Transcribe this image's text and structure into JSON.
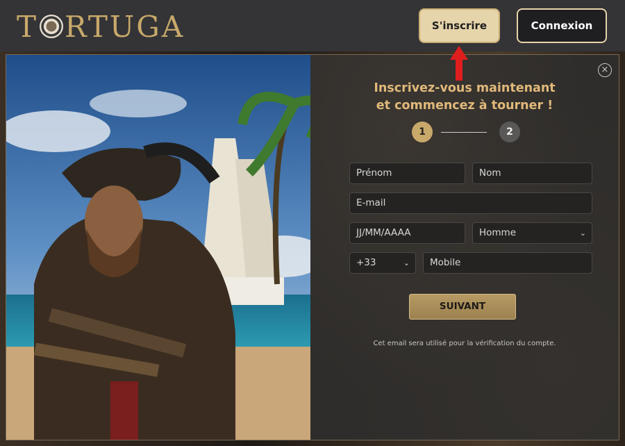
{
  "header": {
    "logo_text_left": "T",
    "logo_text_right": "RTUGA",
    "signup_label": "S'inscrire",
    "login_label": "Connexion"
  },
  "modal": {
    "title_line1": "Inscrivez-vous maintenant",
    "title_line2": "et commencez à tourner !",
    "close_icon": "×",
    "steps": [
      "1",
      "2"
    ],
    "fields": {
      "first_name_placeholder": "Prénom",
      "last_name_placeholder": "Nom",
      "email_placeholder": "E-mail",
      "birthdate_placeholder": "JJ/MM/AAAA",
      "gender_value": "Homme",
      "phone_code_value": "+33",
      "mobile_placeholder": "Mobile"
    },
    "next_label": "SUIVANT",
    "note": "Cet email sera utilisé pour la vérification du compte."
  },
  "colors": {
    "accent_gold": "#c8a96a",
    "signup_bg": "#e6d4aa",
    "arrow_red": "#e01e1e"
  },
  "icons": [
    "close-icon",
    "chevron-down-icon",
    "red-arrow-up-icon"
  ]
}
